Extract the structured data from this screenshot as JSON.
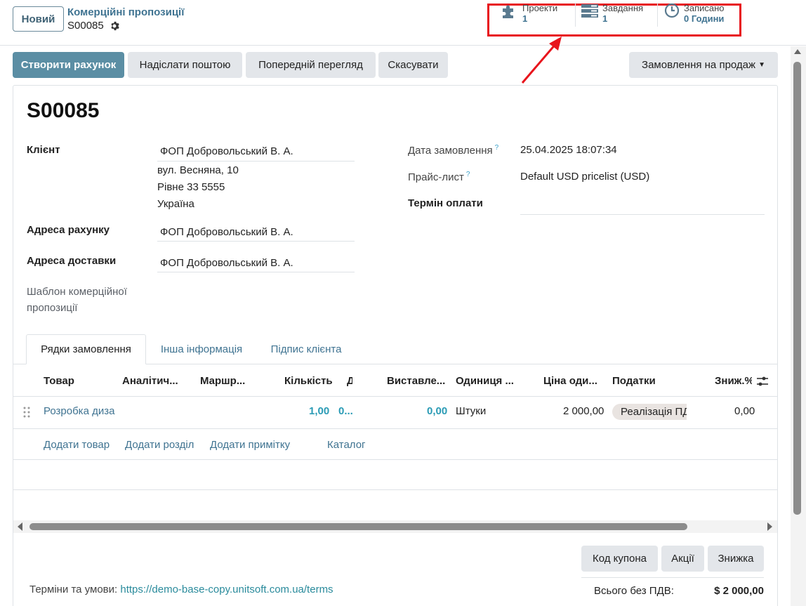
{
  "control_panel": {
    "new_button": "Новий",
    "breadcrumb_parent": "Комерційні пропозиції",
    "breadcrumb_current": "S00085",
    "stats": [
      {
        "label": "Проекти",
        "value": "1",
        "icon": "puzzle-icon"
      },
      {
        "label": "Завдання",
        "value": "1",
        "icon": "tasks-icon"
      },
      {
        "label": "Записано",
        "value": "0 Години",
        "icon": "clock-icon"
      }
    ]
  },
  "actions": {
    "create_invoice": "Створити рахунок",
    "send_email": "Надіслати поштою",
    "preview": "Попередній перегляд",
    "cancel": "Скасувати",
    "sales_order_menu": "Замовлення на продаж"
  },
  "form": {
    "title": "S00085",
    "client_label": "Клієнт",
    "client_name": "ФОП Добровольський В. А.",
    "client_address": [
      "вул. Весняна, 10",
      "Рівне 33 5555",
      "Україна"
    ],
    "invoice_address_label": "Адреса рахунку",
    "invoice_address": "ФОП Добровольський В. А.",
    "delivery_address_label": "Адреса доставки",
    "delivery_address": "ФОП Добровольський В. А.",
    "template_label": "Шаблон комерційної пропозиції",
    "order_date_label": "Дата замовлення",
    "order_date": "25.04.2025 18:07:34",
    "pricelist_label": "Прайс-лист",
    "pricelist": "Default USD pricelist (USD)",
    "payment_terms_label": "Термін оплати",
    "help_mark": "?"
  },
  "tabs": [
    "Рядки замовлення",
    "Інша інформація",
    "Підпис клієнта"
  ],
  "table": {
    "headers": [
      "Товар",
      "Аналітич...",
      "Маршр...",
      "Кількість",
      "Д",
      "Виставле...",
      "Одиниця ...",
      "Ціна оди...",
      "Податки",
      "Зниж.%"
    ],
    "row": {
      "product": "Розробка диза",
      "quantity": "1,00",
      "delivered": "0...",
      "invoiced": "0,00",
      "uom": "Штуки",
      "unit_price": "2 000,00",
      "tax": "Реалізація ПДВ",
      "discount": "0,00"
    },
    "add_links": [
      "Додати товар",
      "Додати розділ",
      "Додати примітку",
      "Каталог"
    ]
  },
  "bottom": {
    "coupon": "Код купона",
    "promotions": "Акції",
    "discount": "Знижка",
    "terms_label": "Терміни та умови:",
    "terms_link": "https://demo-base-copy.unitsoft.com.ua/terms",
    "subtotal_label": "Всього без ПДВ:",
    "subtotal_value": "$ 2 000,00"
  },
  "colors": {
    "primary": "#5b8ea4",
    "link": "#3f7391",
    "highlight": "#e8141c"
  }
}
